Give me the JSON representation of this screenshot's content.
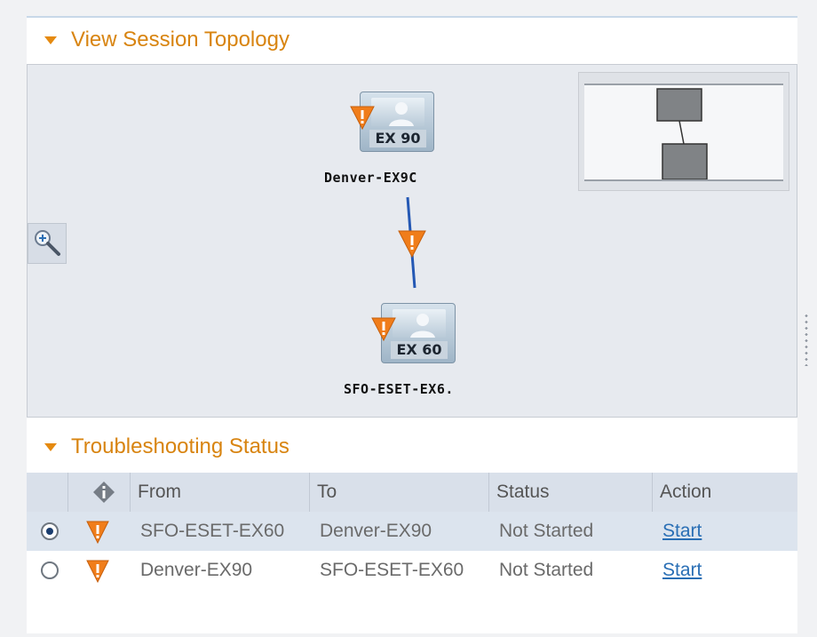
{
  "topology": {
    "title": "View Session Topology",
    "nodes": [
      {
        "name": "Denver-EX9C",
        "model": "EX 90",
        "icon": "video-endpoint-icon",
        "warning_icon": "warning-icon"
      },
      {
        "name": "SFO-ESET-EX6.",
        "model": "EX 60",
        "icon": "video-endpoint-icon",
        "warning_icon": "warning-icon"
      }
    ],
    "link_warning_icon": "warning-icon",
    "zoom_icon": "zoom-in-icon",
    "minimap_icon": "minimap-overview"
  },
  "troubleshooting": {
    "title": "Troubleshooting Status",
    "columns": {
      "info_icon": "info-diamond-icon",
      "from": "From",
      "to": "To",
      "status": "Status",
      "action": "Action"
    },
    "rows": [
      {
        "selected": true,
        "from": "SFO-ESET-EX60",
        "to": "Denver-EX90",
        "status": "Not Started",
        "action": "Start"
      },
      {
        "selected": false,
        "from": "Denver-EX90",
        "to": "SFO-ESET-EX60",
        "status": "Not Started",
        "action": "Start"
      }
    ]
  },
  "colors": {
    "accent": "#d88410",
    "warning": "#f07d1a",
    "link": "#2a6fb5",
    "topology_bg": "#e7eaef",
    "header_row": "#d9e0ea"
  }
}
